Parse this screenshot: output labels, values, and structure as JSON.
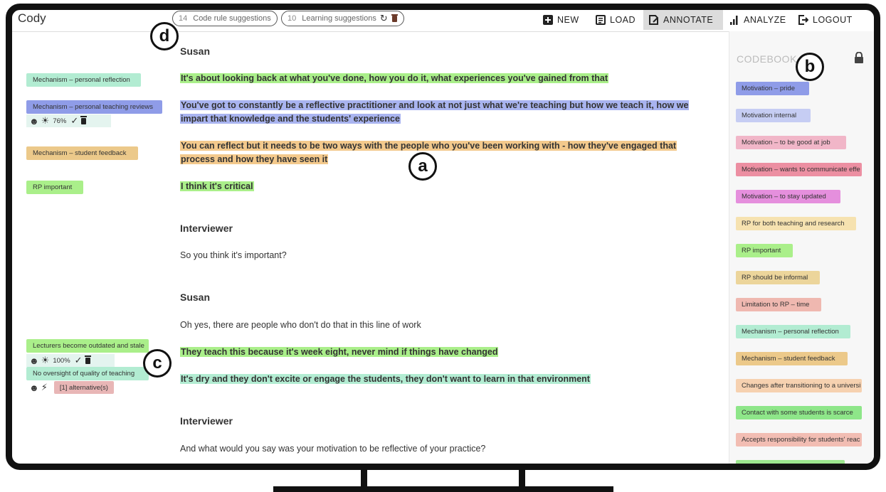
{
  "app": {
    "title": "Cody"
  },
  "topbar": {
    "code_rule": {
      "count": "14",
      "label": "Code rule suggestions"
    },
    "learning": {
      "count": "10",
      "label": "Learning suggestions"
    },
    "nav": [
      {
        "label": "NEW",
        "icon": "plus-box-icon"
      },
      {
        "label": "LOAD",
        "icon": "document-icon"
      },
      {
        "label": "ANNOTATE",
        "icon": "annotate-icon",
        "active": true
      },
      {
        "label": "ANALYZE",
        "icon": "bar-chart-icon"
      },
      {
        "label": "LOGOUT",
        "icon": "logout-icon"
      }
    ]
  },
  "margin_codes": {
    "personal_reflection": {
      "label": "Mechanism – personal reflection",
      "color": "#b2ecd2"
    },
    "teaching_reviews": {
      "label": "Mechanism – personal teaching reviews",
      "color": "#8f9ce8",
      "confidence": "76%"
    },
    "student_feedback": {
      "label": "Mechanism – student feedback",
      "color": "#ecc98a"
    },
    "rp_important": {
      "label": "RP important",
      "color": "#aaef8a"
    },
    "outdated": {
      "label": "Lecturers become outdated and stale",
      "color": "#aaef8a",
      "confidence": "100%"
    },
    "oversight": {
      "label": "No oversight of quality of teaching",
      "color": "#b2ecd2"
    },
    "alternatives": {
      "label": "[1] alternative(s)",
      "color": "#e8b6b6"
    }
  },
  "transcript": {
    "s1": "Susan",
    "p1": "It's about looking back at what you've done, how you do it, what experiences you've gained from that",
    "p2": "You've got to constantly be a reflective practitioner and look at not just what we're teaching but how we teach it, how we impart that knowledge and the students' experience",
    "p3": "You can reflect but it needs to be two ways with the people who you've been working with - how they've engaged that process and how they have seen it",
    "p4": "I think it's critical",
    "s2": "Interviewer",
    "p5": "So you think it's important?",
    "s3": "Susan",
    "p6": "Oh yes, there are people who don't do that in this line of work",
    "p7": "They teach this because it's week eight, never mind if things have changed",
    "p8": "It's dry and they don't excite or engage the students, they don't want to learn in that environment",
    "s4": "Interviewer",
    "p9": "And what would you say was your motivation to be reflective of your practice?"
  },
  "codebook": {
    "title": "CODEBOOK",
    "items": [
      {
        "label": "Motivation – pride",
        "color": "#8f9ce8"
      },
      {
        "label": "Motivation internal",
        "color": "#c6cdf3"
      },
      {
        "label": "Motivation – to be good at job",
        "color": "#f1b6c8"
      },
      {
        "label": "Motivation – wants to communicate effe",
        "color": "#ec8fa2"
      },
      {
        "label": "Motivation – to stay updated",
        "color": "#e58fdd"
      },
      {
        "label": "RP for both teaching and research",
        "color": "#f6e2b0"
      },
      {
        "label": "RP important",
        "color": "#aaef8a"
      },
      {
        "label": "RP should be informal",
        "color": "#ecd59b"
      },
      {
        "label": "Limitation to RP – time",
        "color": "#efb8b0"
      },
      {
        "label": "Mechanism – personal reflection",
        "color": "#b2ecd2"
      },
      {
        "label": "Mechanism – student feedback",
        "color": "#ecc98a"
      },
      {
        "label": "Changes after transitioning to a universi",
        "color": "#f6d1b0"
      },
      {
        "label": "Contact with some students is scarce",
        "color": "#8ee689"
      },
      {
        "label": "Accepts responsibility for students' reac",
        "color": "#f2bdb3"
      },
      {
        "label": "",
        "color": "#9de68f"
      }
    ]
  },
  "callouts": {
    "a": "a",
    "b": "b",
    "c": "c",
    "d": "d"
  },
  "colors": {
    "green": "#aaef8a",
    "blue": "#a9b4f0",
    "orange": "#f3c98c",
    "mint": "#b2ecd2"
  }
}
